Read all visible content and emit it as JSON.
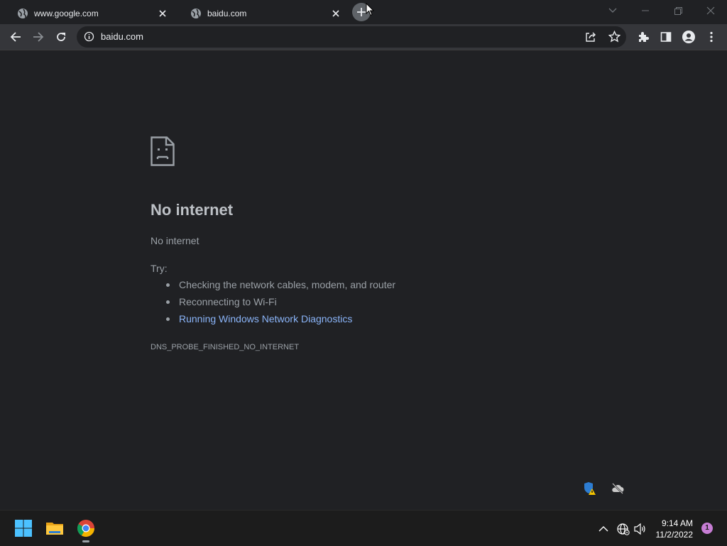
{
  "tabs": [
    {
      "title": "www.google.com",
      "favicon": "globe-icon"
    },
    {
      "title": "baidu.com",
      "favicon": "globe-icon"
    }
  ],
  "toolbar": {
    "url": "baidu.com"
  },
  "error": {
    "icon": "sad-page-icon",
    "heading": "No internet",
    "subtitle": "No internet",
    "try_label": "Try:",
    "suggestions": [
      "Checking the network cables, modem, and router",
      "Reconnecting to Wi-Fi",
      "Running Windows Network Diagnostics"
    ],
    "code": "DNS_PROBE_FINISHED_NO_INTERNET"
  },
  "taskbar": {
    "time": "9:14 AM",
    "date": "11/2/2022",
    "notifications": "1"
  },
  "colors": {
    "background": "#202124",
    "link": "#8ab4f8",
    "toolbar": "#35363a"
  }
}
